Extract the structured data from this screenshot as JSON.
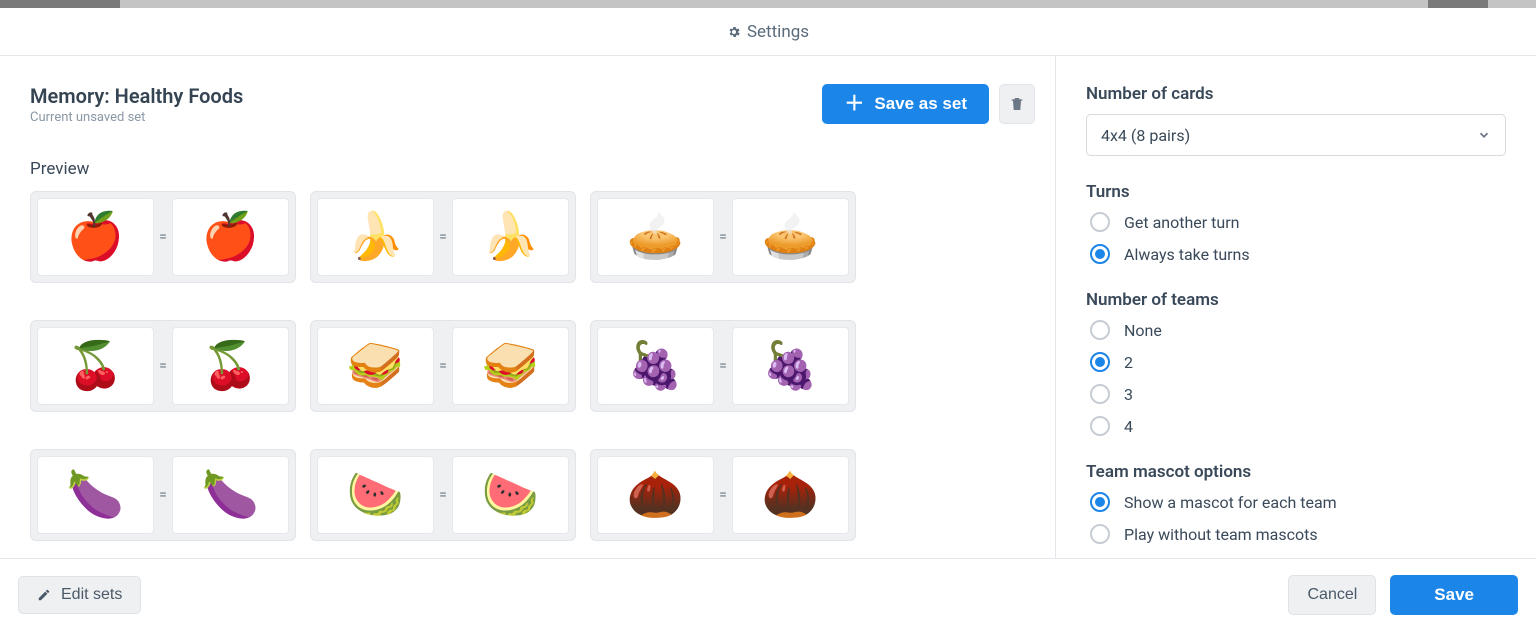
{
  "settings_label": "Settings",
  "set": {
    "title": "Memory: Healthy Foods",
    "subtitle": "Current unsaved set",
    "save_as_set": "Save as set",
    "preview_label": "Preview"
  },
  "pairs": [
    {
      "left_glyph": "🍎",
      "right_glyph": "🍎",
      "name": "apple"
    },
    {
      "left_glyph": "🍌",
      "right_glyph": "🍌",
      "name": "banana"
    },
    {
      "left_glyph": "🥧",
      "right_glyph": "🥧",
      "name": "strawberry-tart"
    },
    {
      "left_glyph": "🍒",
      "right_glyph": "🍒",
      "name": "red-currants"
    },
    {
      "left_glyph": "🥪",
      "right_glyph": "🥪",
      "name": "sandwich"
    },
    {
      "left_glyph": "🍇",
      "right_glyph": "🍇",
      "name": "grapes"
    },
    {
      "left_glyph": "🍆",
      "right_glyph": "🍆",
      "name": "eggplant"
    },
    {
      "left_glyph": "🍉",
      "right_glyph": "🍉",
      "name": "watermelon"
    },
    {
      "left_glyph": "🌰",
      "right_glyph": "🌰",
      "name": "nuts"
    }
  ],
  "options": {
    "num_cards_label": "Number of cards",
    "num_cards_value": "4x4 (8 pairs)",
    "turns_label": "Turns",
    "turns": [
      {
        "label": "Get another turn",
        "checked": false
      },
      {
        "label": "Always take turns",
        "checked": true
      }
    ],
    "teams_label": "Number of teams",
    "teams": [
      {
        "label": "None",
        "checked": false
      },
      {
        "label": "2",
        "checked": true
      },
      {
        "label": "3",
        "checked": false
      },
      {
        "label": "4",
        "checked": false
      }
    ],
    "mascot_label": "Team mascot options",
    "mascot": [
      {
        "label": "Show a mascot for each team",
        "checked": true
      },
      {
        "label": "Play without team mascots",
        "checked": false
      }
    ]
  },
  "footer": {
    "edit_sets": "Edit sets",
    "cancel": "Cancel",
    "save": "Save"
  }
}
